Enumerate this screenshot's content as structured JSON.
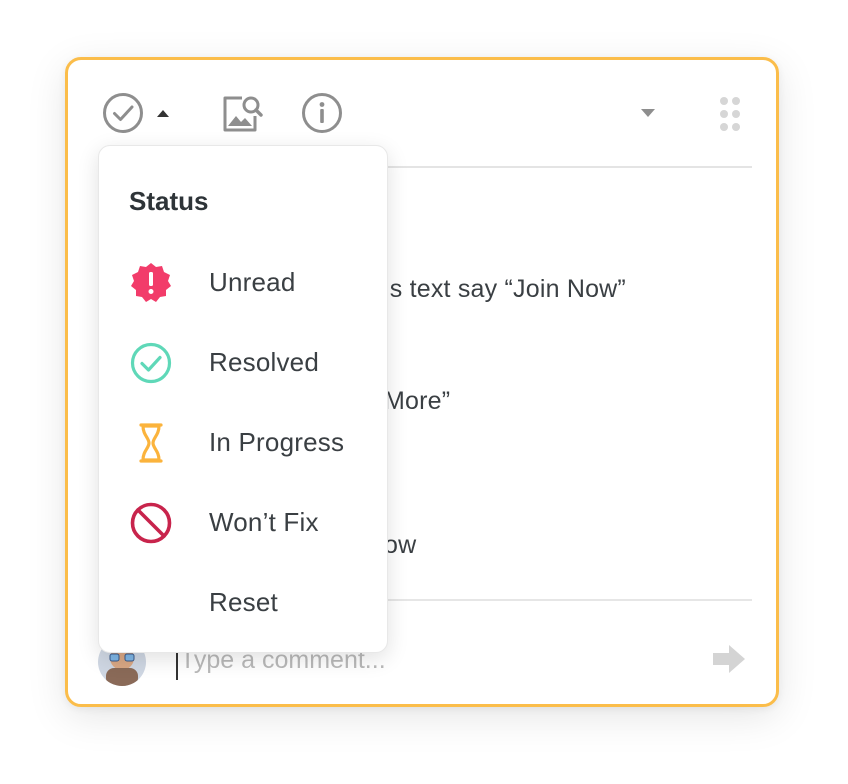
{
  "comments": {
    "line1": "is text say “Join Now”",
    "line2": "More”",
    "line3": "ow"
  },
  "composer": {
    "placeholder": "Type a comment..."
  },
  "status_menu": {
    "title": "Status",
    "items": [
      {
        "label": "Unread",
        "icon": "alert-badge-icon",
        "color": "#f23c6a"
      },
      {
        "label": "Resolved",
        "icon": "check-circle-icon",
        "color": "#5fd8b8"
      },
      {
        "label": "In Progress",
        "icon": "hourglass-icon",
        "color": "#fbb33c"
      },
      {
        "label": "Won’t Fix",
        "icon": "prohibited-icon",
        "color": "#c8244c"
      },
      {
        "label": "Reset",
        "icon": "",
        "color": ""
      }
    ]
  },
  "colors": {
    "accent_border": "#fbbd4a",
    "icon_gray": "#8e8e8e"
  }
}
